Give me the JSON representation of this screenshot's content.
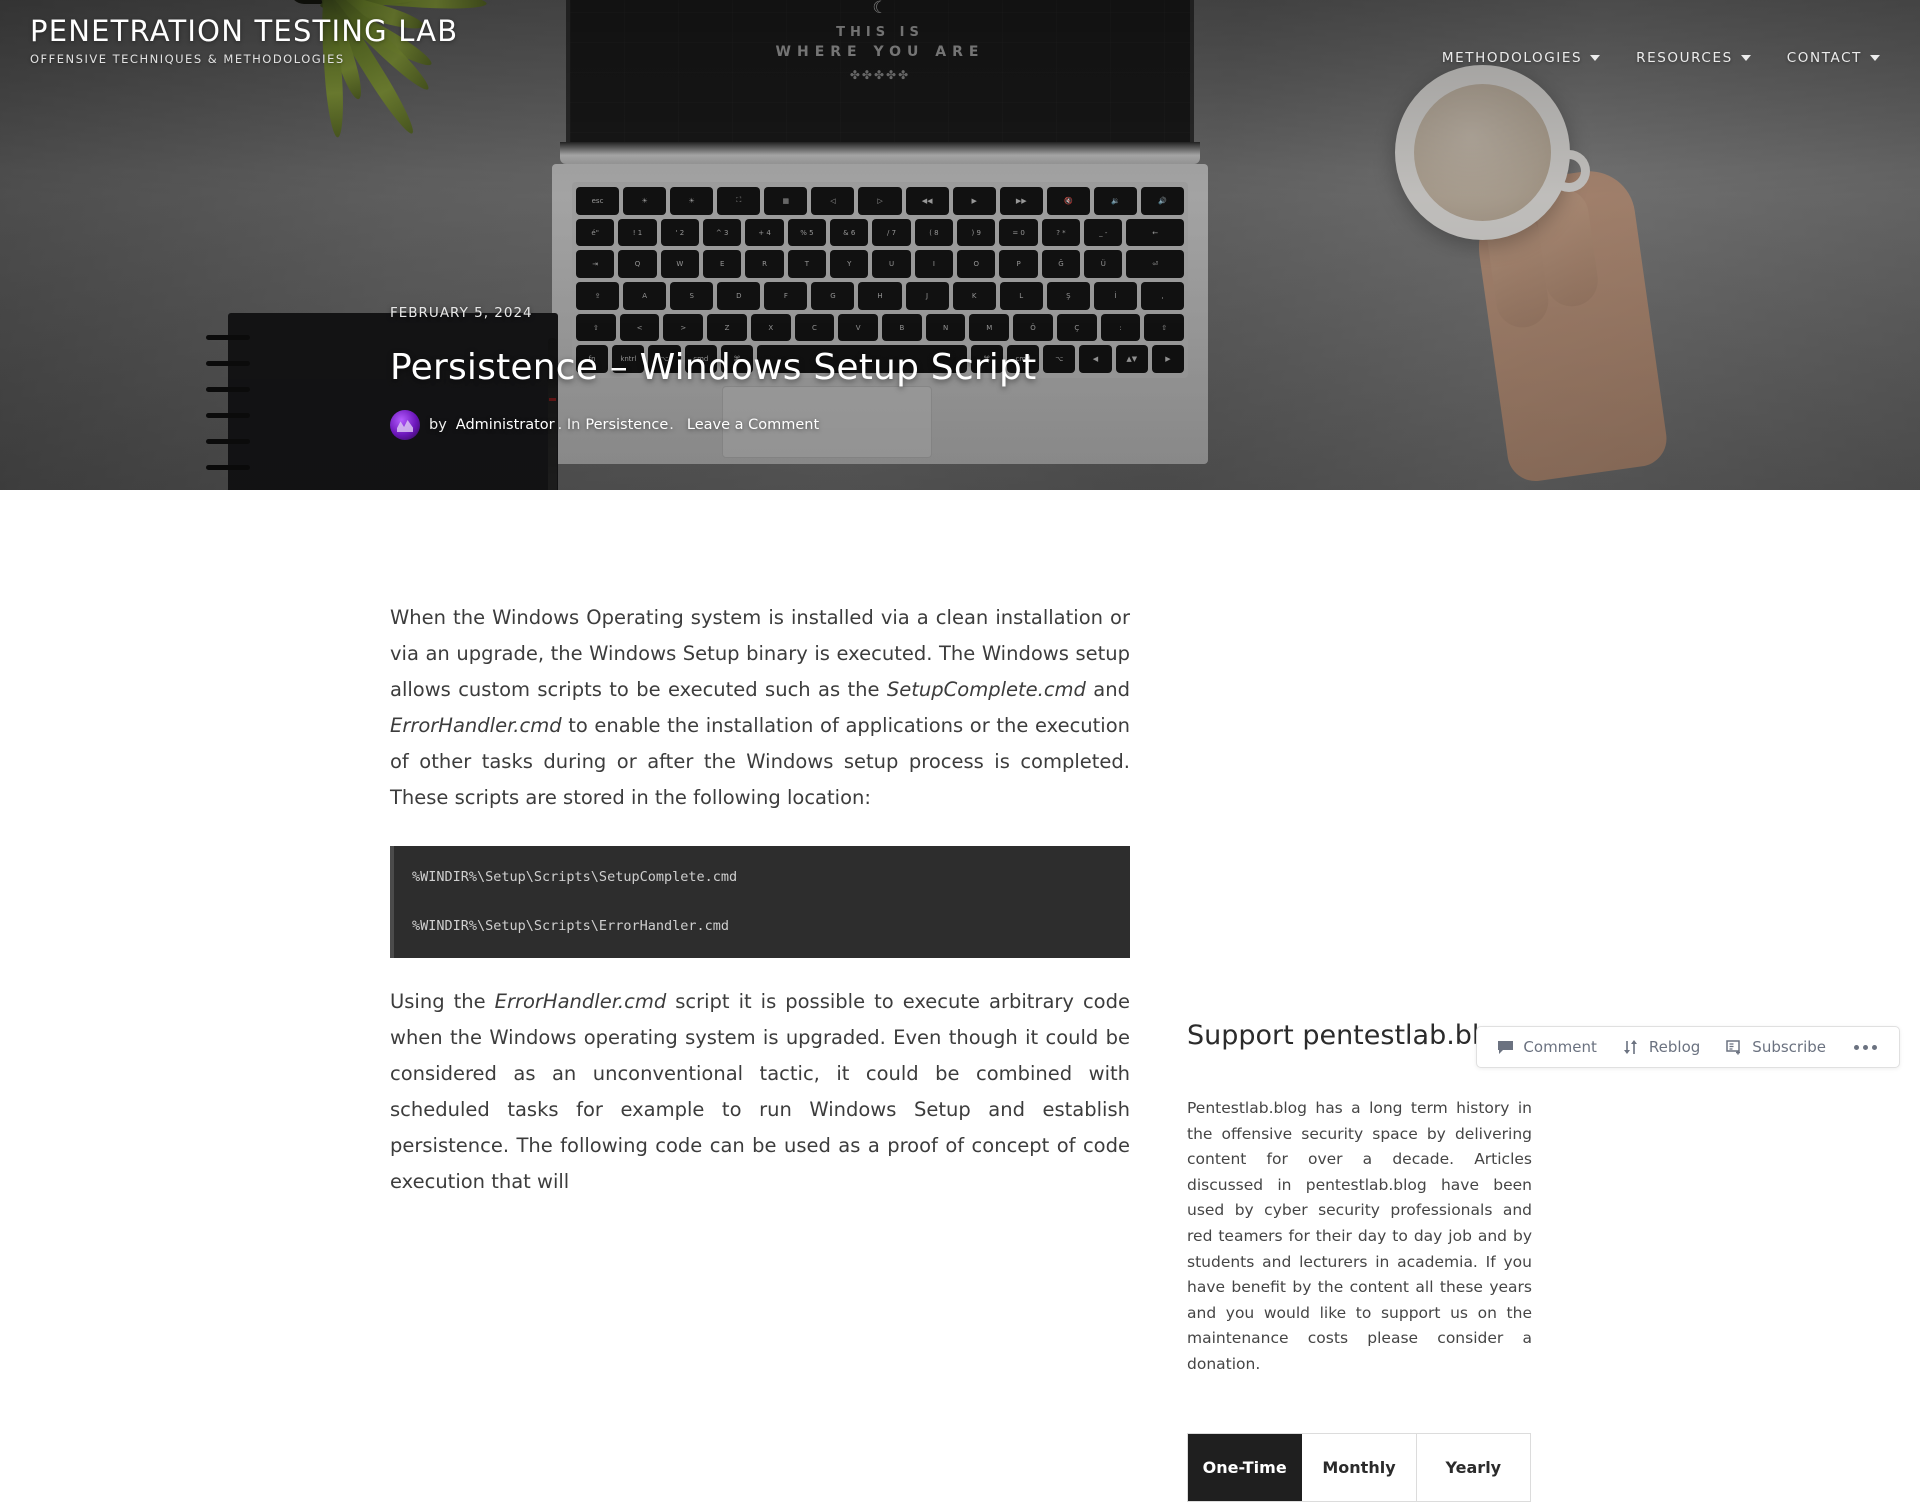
{
  "header": {
    "site_title": "PENETRATION TESTING LAB",
    "tagline": "OFFENSIVE TECHNIQUES & METHODOLOGIES",
    "nav": [
      {
        "label": "METHODOLOGIES",
        "has_dropdown": true
      },
      {
        "label": "RESOURCES",
        "has_dropdown": true
      },
      {
        "label": "CONTACT",
        "has_dropdown": true
      }
    ]
  },
  "hero": {
    "laptop_screen": {
      "moon": "☾",
      "line1": "THIS IS",
      "line2": "WHERE YOU ARE",
      "ornament": "✤✤✤✤✤"
    },
    "keyboard_rows": [
      [
        "esc",
        "☀",
        "☀",
        "⛶",
        "▦",
        "◁",
        "▷",
        "◀◀",
        "▶",
        "▶▶",
        "🔇",
        "🔉",
        "🔊"
      ],
      [
        "é\"",
        "!\n1",
        "'\n2",
        "^\n3",
        "+\n4",
        "%\n5",
        "&\n6",
        "/\n7",
        "(\n8",
        ")\n9",
        "=\n0",
        "?\n*",
        "_\n-",
        "←"
      ],
      [
        "⇥",
        "Q",
        "W",
        "E",
        "R",
        "T",
        "Y",
        "U",
        "I",
        "O",
        "P",
        "Ğ",
        "Ü",
        "⏎"
      ],
      [
        "⇪",
        "A",
        "S",
        "D",
        "F",
        "G",
        "H",
        "J",
        "K",
        "L",
        "Ş",
        "İ",
        ","
      ],
      [
        "⇧",
        "<",
        ">",
        "Z",
        "X",
        "C",
        "V",
        "B",
        "N",
        "M",
        "Ö",
        "Ç",
        ":",
        "⇧"
      ],
      [
        "fn",
        "kntrl",
        "⌥",
        "cmd",
        "⌘",
        "",
        "⌘",
        "cmd",
        "⌥",
        "◀",
        "▲▼",
        "▶"
      ]
    ]
  },
  "post": {
    "date": "FEBRUARY 5, 2024",
    "title": "Persistence – Windows Setup Script",
    "byline_prefix": "by",
    "author": "Administrator",
    "byline_mid": ".  In",
    "category": "Persistence",
    "byline_suffix": ".",
    "comment_link": "Leave a Comment"
  },
  "article": {
    "paragraph_1_parts": [
      {
        "text": "When the Windows Operating system is installed via a clean installation or via an upgrade, the Windows Setup binary is executed. The Windows setup allows custom scripts to be executed such as the ",
        "italic": false
      },
      {
        "text": "SetupComplete.cmd",
        "italic": true
      },
      {
        "text": " and ",
        "italic": false
      },
      {
        "text": "ErrorHandler.cmd",
        "italic": true
      },
      {
        "text": " to enable the installation of applications or the execution of other tasks during or after the Windows setup process is completed. These scripts are stored in the following location:",
        "italic": false
      }
    ],
    "code_lines": [
      "%WINDIR%\\Setup\\Scripts\\SetupComplete.cmd",
      "%WINDIR%\\Setup\\Scripts\\ErrorHandler.cmd"
    ],
    "paragraph_2_parts": [
      {
        "text": "Using the ",
        "italic": false
      },
      {
        "text": "ErrorHandler.cmd",
        "italic": true
      },
      {
        "text": " script it is possible to execute arbitrary code when the Windows operating system is upgraded. Even though it could be considered as an unconventional tactic, it could be combined with scheduled tasks for example to run Windows Setup and establish persistence. The following code can be used as a proof of concept of code execution that will",
        "italic": false
      }
    ]
  },
  "sidebar": {
    "title": "Support pentestlab.blog",
    "body": "Pentestlab.blog has a long term history in the offensive security space by delivering content for over a decade. Articles discussed in pentestlab.blog have been used by cyber security professionals and red teamers for their day to day job and by students and lecturers in academia. If you have benefit by the content all these years and you would like to support us on the maintenance costs please consider a donation.",
    "donation_tabs": [
      {
        "label": "One-Time",
        "active": true
      },
      {
        "label": "Monthly",
        "active": false
      },
      {
        "label": "Yearly",
        "active": false
      }
    ]
  },
  "action_bar": {
    "comment": "Comment",
    "reblog": "Reblog",
    "subscribe": "Subscribe",
    "more": "•••"
  },
  "colors": {
    "code_bg": "#2d2d2d",
    "tab_active_bg": "#1f1f1f",
    "text": "#3c3c3c",
    "action_text": "#6b7280"
  }
}
